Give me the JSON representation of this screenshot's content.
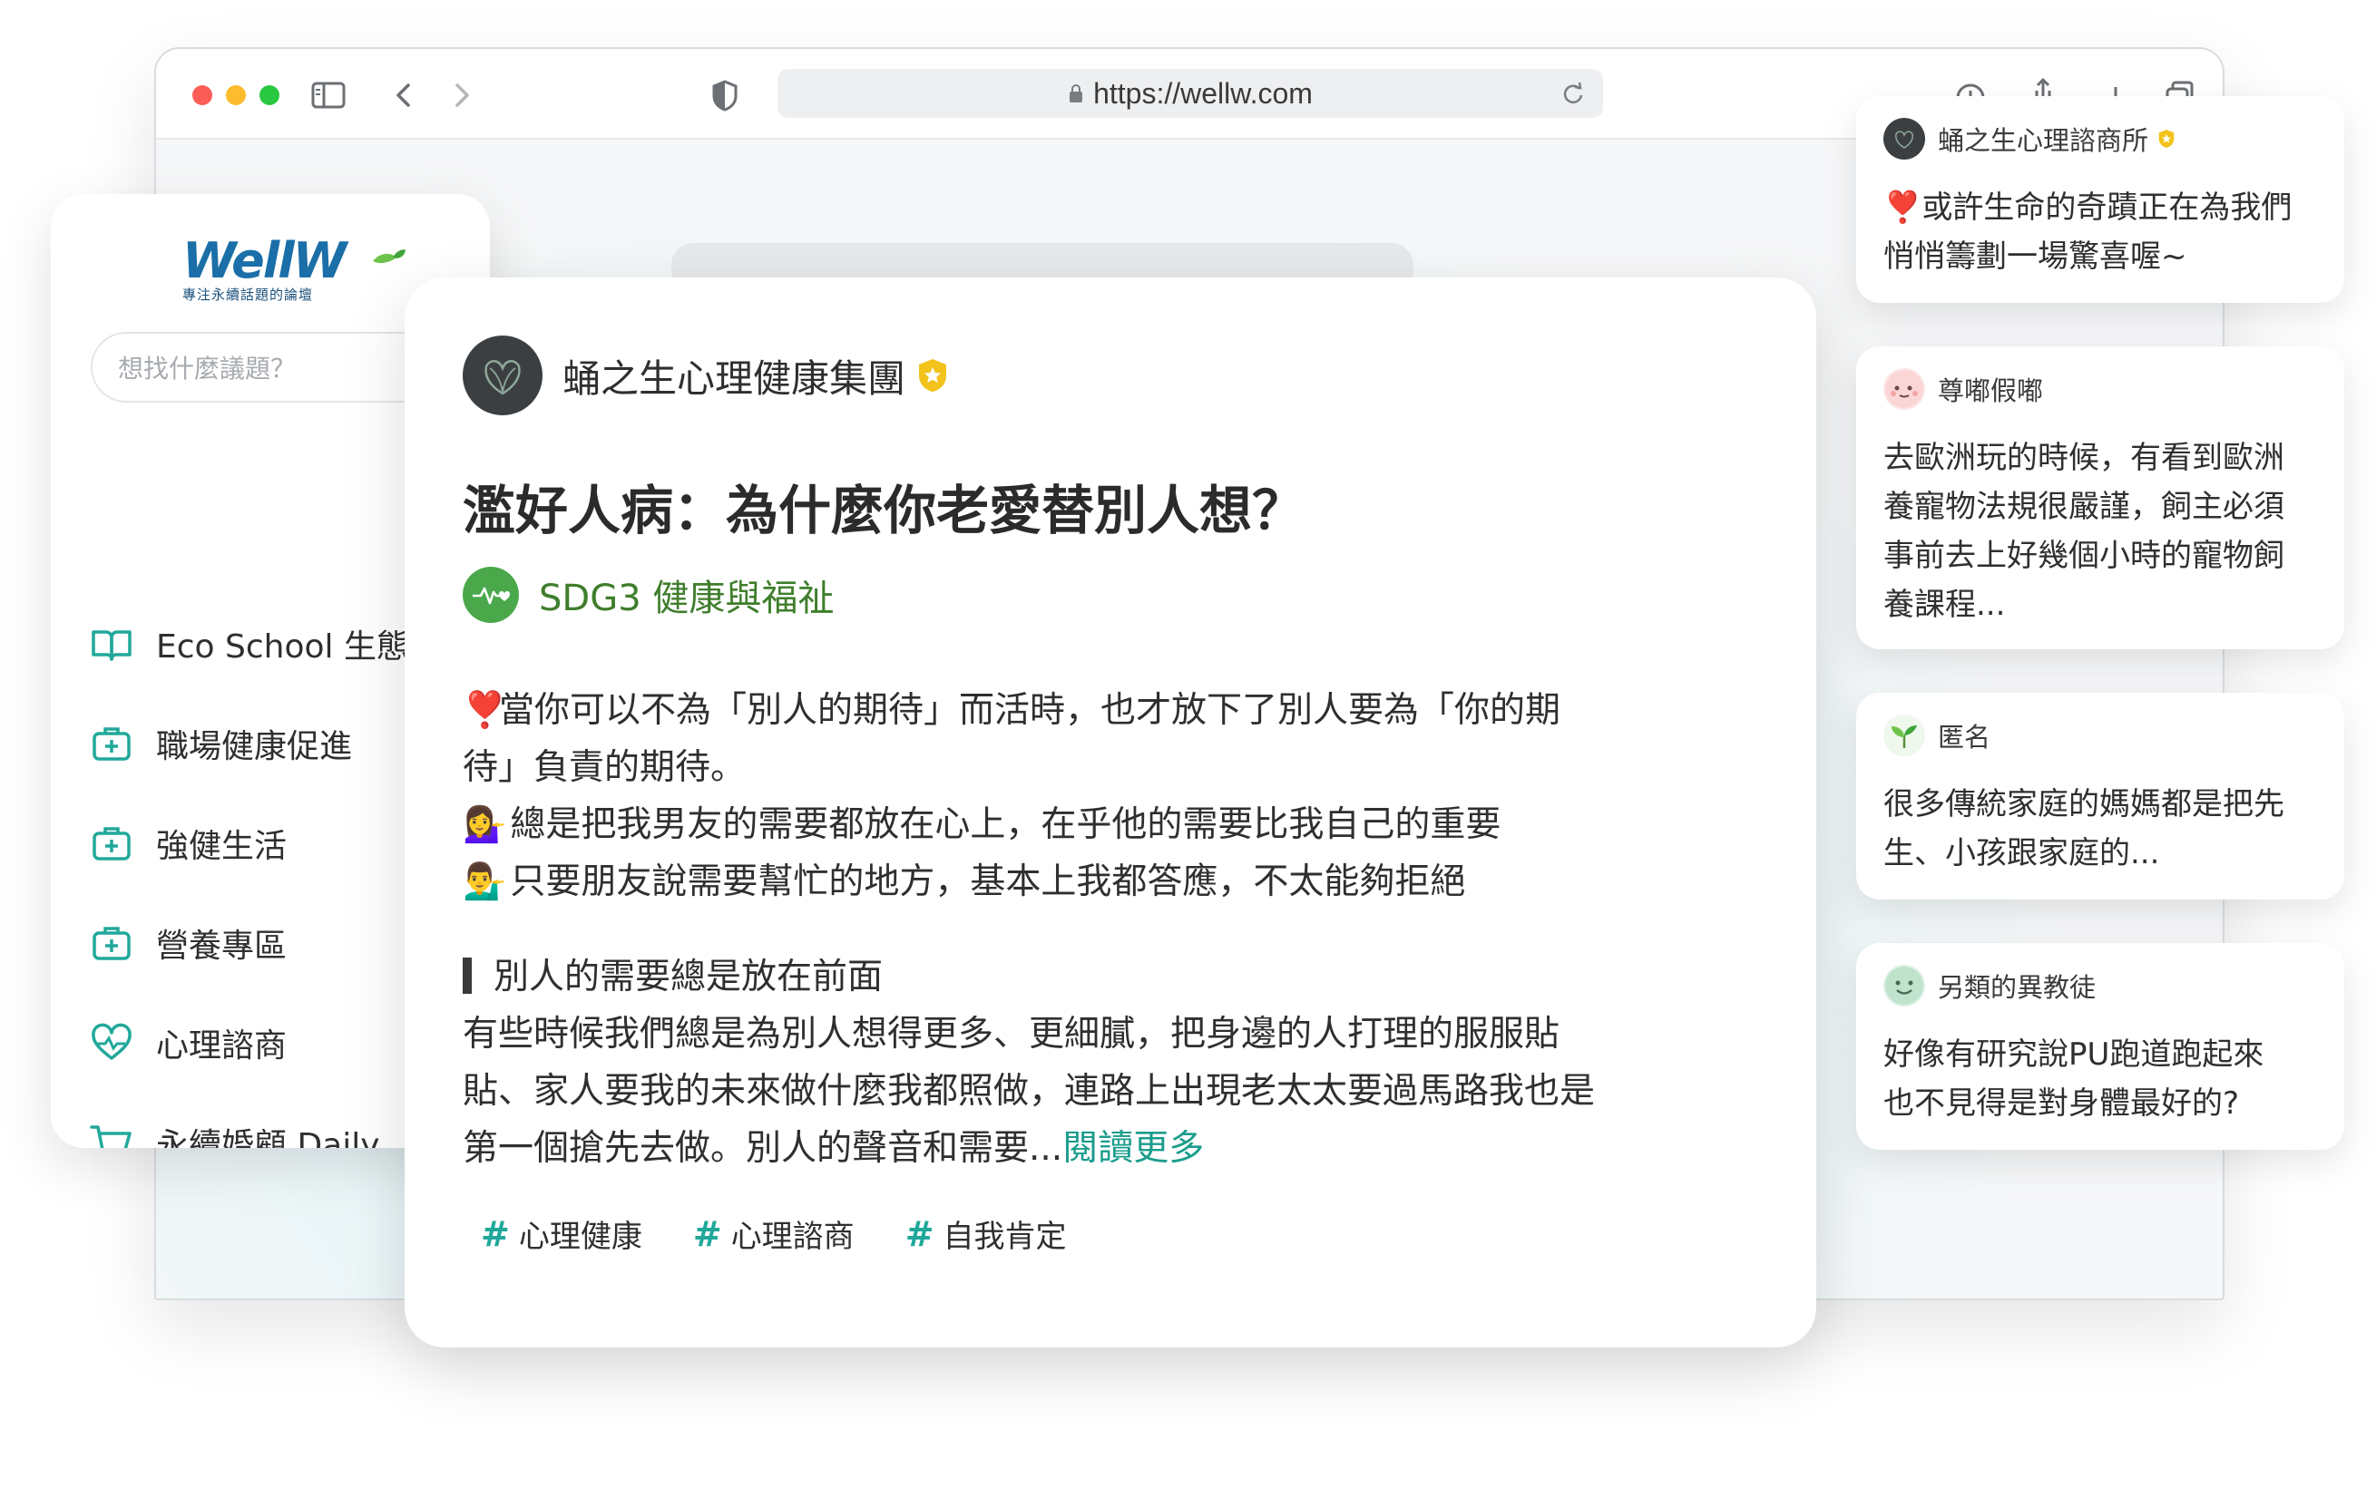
{
  "browser": {
    "url": "https://wellw.com"
  },
  "sidebar": {
    "logo_text": "WellW",
    "logo_tagline": "專注永續話題的論壇",
    "search_placeholder": "想找什麼議題？",
    "items": [
      {
        "label": "Eco School 生態學校",
        "icon": "book-icon"
      },
      {
        "label": "職場健康促進",
        "icon": "first-aid-kit-icon"
      },
      {
        "label": "強健生活",
        "icon": "first-aid-kit-icon"
      },
      {
        "label": "營養專區",
        "icon": "first-aid-kit-icon"
      },
      {
        "label": "心理諮商",
        "icon": "heart-pulse-icon"
      },
      {
        "label": "永續婚顧 Daily",
        "icon": "cart-icon"
      }
    ]
  },
  "post": {
    "author": "蛹之生心理健康集團",
    "verified_icon": "verified-badge-icon",
    "title": "濫好人病：為什麼你老愛替別人想？",
    "category": "SDG3 健康與福祉",
    "body_lines": [
      {
        "emoji": "❣️",
        "text": "當你可以不為「別人的期待」而活時，也才放下了別人要為「你的期"
      },
      {
        "emoji": "",
        "text": "待」負責的期待。"
      },
      {
        "emoji": "💁‍♀️",
        "text": " 總是把我男友的需要都放在心上，在乎他的需要比我自己的重要"
      },
      {
        "emoji": "💁‍♂️",
        "text": " 只要朋友說需要幫忙的地方，基本上我都答應，不太能夠拒絕"
      }
    ],
    "subheading": "別人的需要總是放在前面",
    "paragraph_lines": [
      "有些時候我們總是為別人想得更多、更細膩，把身邊的人打理的服服貼",
      "貼、家人要我的未來做什麼我都照做，連路上出現老太太要過馬路我也是",
      "第一個搶先去做。別人的聲音和需要..."
    ],
    "read_more": "閱讀更多",
    "tags": [
      "心理健康",
      "心理諮商",
      "自我肯定"
    ],
    "tag_symbol": "#"
  },
  "comments": [
    {
      "name": "蛹之生心理諮商所",
      "verified": true,
      "lines": [
        "❣️或許生命的奇蹟正在為我們",
        "悄悄籌劃一場驚喜喔~"
      ]
    },
    {
      "name": "尊嘟假嘟",
      "verified": false,
      "lines": [
        "去歐洲玩的時候，有看到歐洲",
        "養寵物法規很嚴謹，飼主必須",
        "事前去上好幾個小時的寵物飼",
        "養課程..."
      ]
    },
    {
      "name": "匿名",
      "verified": false,
      "lines": [
        "很多傳統家庭的媽媽都是把先",
        "生、小孩跟家庭的..."
      ]
    },
    {
      "name": "另類的異教徒",
      "verified": false,
      "lines": [
        "好像有研究說PU跑道跑起來",
        "也不見得是對身體最好的?"
      ]
    }
  ],
  "colors": {
    "accent_teal": "#21a89a",
    "sdg_green": "#4aa84b",
    "verified_gold": "#f3c21b",
    "logo_blue": "#1b6fa8"
  }
}
